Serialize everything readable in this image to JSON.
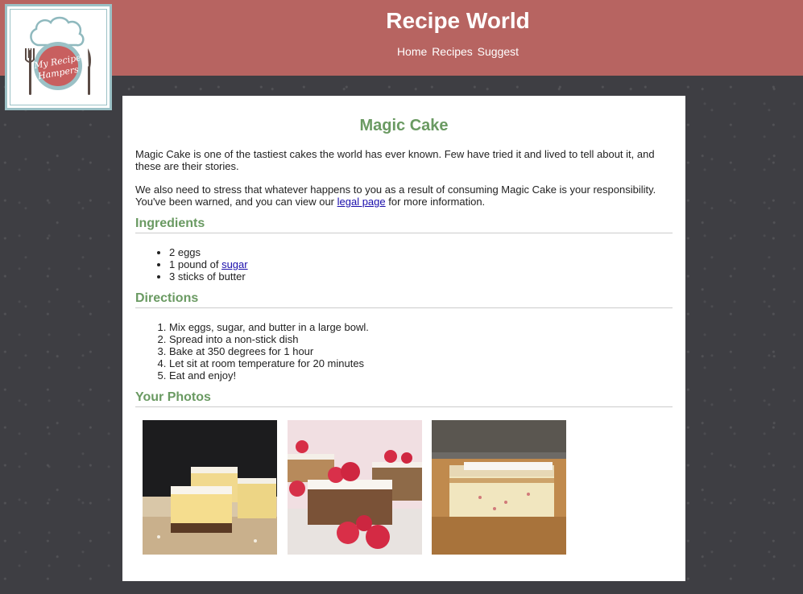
{
  "header": {
    "title": "Recipe World",
    "nav": [
      "Home",
      "Recipes",
      "Suggest"
    ]
  },
  "logo": {
    "text_line1": "My Recipe",
    "text_line2": "Hampers"
  },
  "recipe": {
    "title": "Magic Cake",
    "intro": "Magic Cake is one of the tastiest cakes the world has ever known. Few have tried it and lived to tell about it, and these are their stories.",
    "warning_before": "We also need to stress that whatever happens to you as a result of consuming Magic Cake is your responsibility. You've been warned, and you can view our ",
    "warning_link": "legal page",
    "warning_after": " for more information."
  },
  "ingredients": {
    "heading": "Ingredients",
    "items": [
      {
        "text": "2 eggs"
      },
      {
        "prefix": "1 pound of ",
        "link": "sugar"
      },
      {
        "text": "3 sticks of butter"
      }
    ]
  },
  "directions": {
    "heading": "Directions",
    "steps": [
      "Mix eggs, sugar, and butter in a large bowl.",
      "Spread into a non-stick dish",
      "Bake at 350 degrees for 1 hour",
      "Let sit at room temperature for 20 minutes",
      "Eat and enjoy!"
    ]
  },
  "photos": {
    "heading": "Your Photos"
  },
  "colors": {
    "header_bg": "#b76461",
    "page_bg": "#3e3e43",
    "accent_green": "#6a9a62",
    "link_blue": "#1a0dab"
  }
}
